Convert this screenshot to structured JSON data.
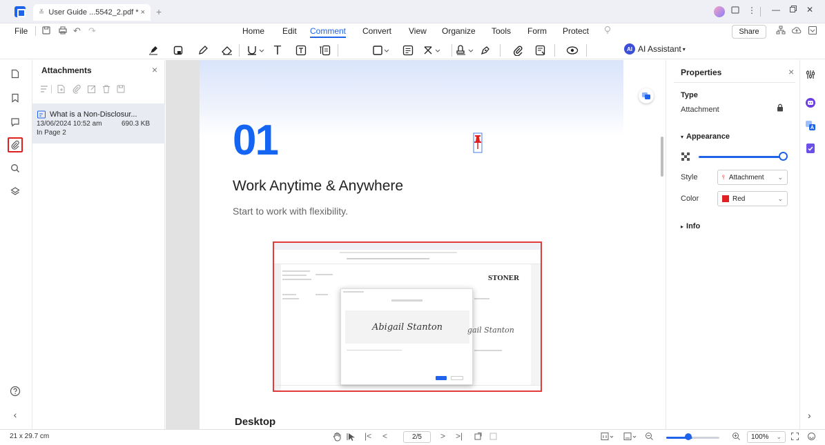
{
  "titlebar": {
    "tab_title": "User Guide ...5542_2.pdf *",
    "new_tab": "+"
  },
  "menu": {
    "file": "File",
    "items": [
      "Home",
      "Edit",
      "Comment",
      "Convert",
      "View",
      "Organize",
      "Tools",
      "Form",
      "Protect"
    ],
    "active": "Comment",
    "share": "Share"
  },
  "toolbar": {
    "ai_assistant": "AI Assistant",
    "ai_badge": "AI"
  },
  "attachments": {
    "title": "Attachments",
    "item": {
      "name": "What is a Non-Disclosur...",
      "date": "13/06/2024 10:52 am",
      "size": "690.3 KB",
      "page": "In Page 2"
    }
  },
  "document": {
    "number": "01",
    "heading": "Work Anytime & Anywhere",
    "subheading": "Start to work with flexibility.",
    "section": "Desktop",
    "embedded": {
      "brand": "STONER",
      "signature": "Abigail Stanton",
      "signature_partial": "gail Stanton"
    }
  },
  "properties": {
    "title": "Properties",
    "type_label": "Type",
    "type_value": "Attachment",
    "appearance": "Appearance",
    "style_label": "Style",
    "style_value": "Attachment",
    "color_label": "Color",
    "color_value": "Red",
    "color_hex": "#e02020",
    "info": "Info",
    "opacity": 1.0
  },
  "status": {
    "page_size": "21 x 29.7 cm",
    "page_indicator": "2/5",
    "zoom": "100%",
    "zoom_fraction": 0.4
  },
  "colors": {
    "accent": "#1e63e9",
    "page_number": "#1365f2",
    "highlight": "#e02020"
  }
}
